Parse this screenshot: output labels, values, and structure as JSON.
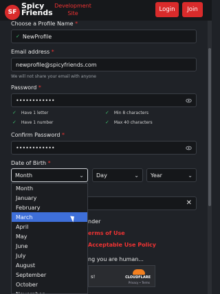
{
  "header": {
    "logo_badge": "SF",
    "logo_line1": "Spicy",
    "logo_line2": "Friends",
    "dev_line1": "Development",
    "dev_line2": "Site",
    "login_label": "Login",
    "join_label": "Join"
  },
  "form": {
    "profile_label": "Choose a Profile Name",
    "profile_value": "NewProfile",
    "email_label": "Email address",
    "email_value": "newprofile@spicyfriends.com",
    "email_hint": "We will not share your email with anyone",
    "password_label": "Password",
    "password_value": "••••••••••••",
    "checks": [
      "Have 1 letter",
      "Min 8 characters",
      "Have 1 number",
      "Max 40 characters"
    ],
    "confirm_label": "Confirm Password",
    "confirm_value": "••••••••••••",
    "dob_label": "Date of Birth",
    "month_value": "Month",
    "day_value": "Day",
    "year_value": "Year",
    "required_mark": "*"
  },
  "month_options": [
    "Month",
    "January",
    "February",
    "March",
    "April",
    "May",
    "June",
    "July",
    "August",
    "September",
    "October",
    "November"
  ],
  "selected_month": "March",
  "obscured": {
    "gender_fragment": "nder",
    "terms_fragment": "erms of Use",
    "aup_fragment": "Acceptable Use Policy",
    "human_fragment": "ng you are human...",
    "captcha_fragment": "s!",
    "cloudflare_logo": "CLOUDFLARE",
    "cloudflare_links": "Privacy • Terms"
  },
  "colors": {
    "accent": "#d92b2b",
    "highlight": "#3e6fd9",
    "check": "#3fbf6f"
  }
}
